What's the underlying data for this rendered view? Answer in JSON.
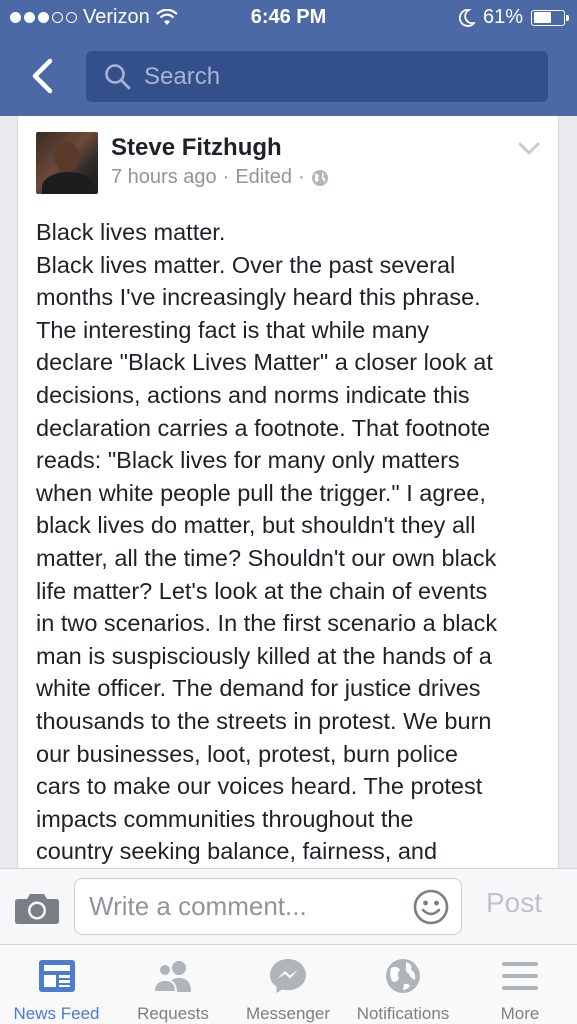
{
  "status": {
    "carrier": "Verizon",
    "time": "6:46 PM",
    "battery": "61%",
    "battery_level": 0.61
  },
  "nav": {
    "search_placeholder": "Search"
  },
  "post": {
    "author": "Steve Fitzhugh",
    "time": "7 hours ago",
    "edited": "Edited",
    "separator": "·",
    "body_lines": [
      "Black lives matter.",
      "Black lives matter. Over the past several",
      "months I've increasingly heard this phrase.",
      "The interesting fact is that while many",
      "declare \"Black Lives Matter\" a closer look at",
      "decisions, actions and norms indicate this",
      "declaration carries a footnote. That footnote",
      "reads: \"Black lives for many only matters",
      "when white people pull the trigger.\" I agree,",
      "black lives do matter, but shouldn't they all",
      "matter, all the time? Shouldn't our own black",
      "life matter? Let's look at the chain of events",
      "in two scenarios. In the first scenario a black",
      "man is suspisciously killed at the hands of a",
      "white officer. The demand for justice drives",
      "thousands to the streets in protest. We burn",
      "our businesses, loot, protest, burn police",
      "cars to make our voices heard. The protest",
      "impacts communities throughout the",
      "country seeking balance, fairness, and"
    ]
  },
  "comment": {
    "placeholder": "Write a comment...",
    "post_label": "Post"
  },
  "tabs": [
    {
      "label": "News Feed",
      "icon": "news-feed-icon",
      "active": true
    },
    {
      "label": "Requests",
      "icon": "requests-icon",
      "active": false
    },
    {
      "label": "Messenger",
      "icon": "messenger-icon",
      "active": false
    },
    {
      "label": "Notifications",
      "icon": "notifications-icon",
      "active": false
    },
    {
      "label": "More",
      "icon": "more-icon",
      "active": false
    }
  ],
  "colors": {
    "brand": "#4b69a5",
    "active_tab": "#4b7bd2"
  }
}
